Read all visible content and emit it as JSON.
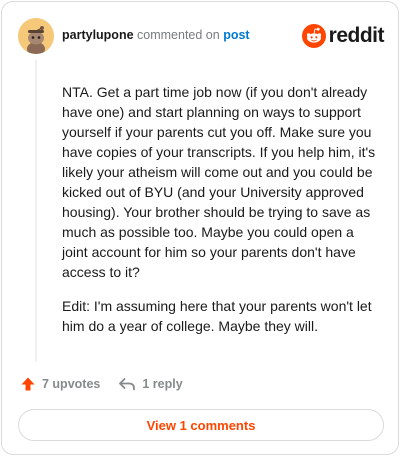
{
  "header": {
    "username": "partylupone",
    "commented_on_text": "commented on",
    "post_link": "post",
    "brand_word": "reddit"
  },
  "comment": {
    "paragraphs": [
      "NTA. Get a part time job now (if you don't already have one) and start planning on ways to support yourself if your parents cut you off. Make sure you have copies of your transcripts. If you help him, it's likely your atheism will come out and you could be kicked out of BYU (and your University approved housing). Your brother should be trying to save as much as possible too. Maybe you could open a joint account for him so your parents don't have access to it?",
      "Edit: I'm assuming here that your parents won't let him do a year of college. Maybe they will."
    ]
  },
  "actions": {
    "upvotes_label": "7 upvotes",
    "reply_label": "1 reply"
  },
  "footer": {
    "view_comments_label": "View 1 comments"
  },
  "colors": {
    "brand_orange": "#ff4500",
    "link_blue": "#0079d3",
    "muted_gray": "#878a8c",
    "border": "#d9dbdc"
  },
  "icons": {
    "avatar": "snoo-avatar-icon",
    "brand": "reddit-logo-icon",
    "upvote": "upvote-arrow-icon",
    "reply": "reply-arrow-icon"
  }
}
